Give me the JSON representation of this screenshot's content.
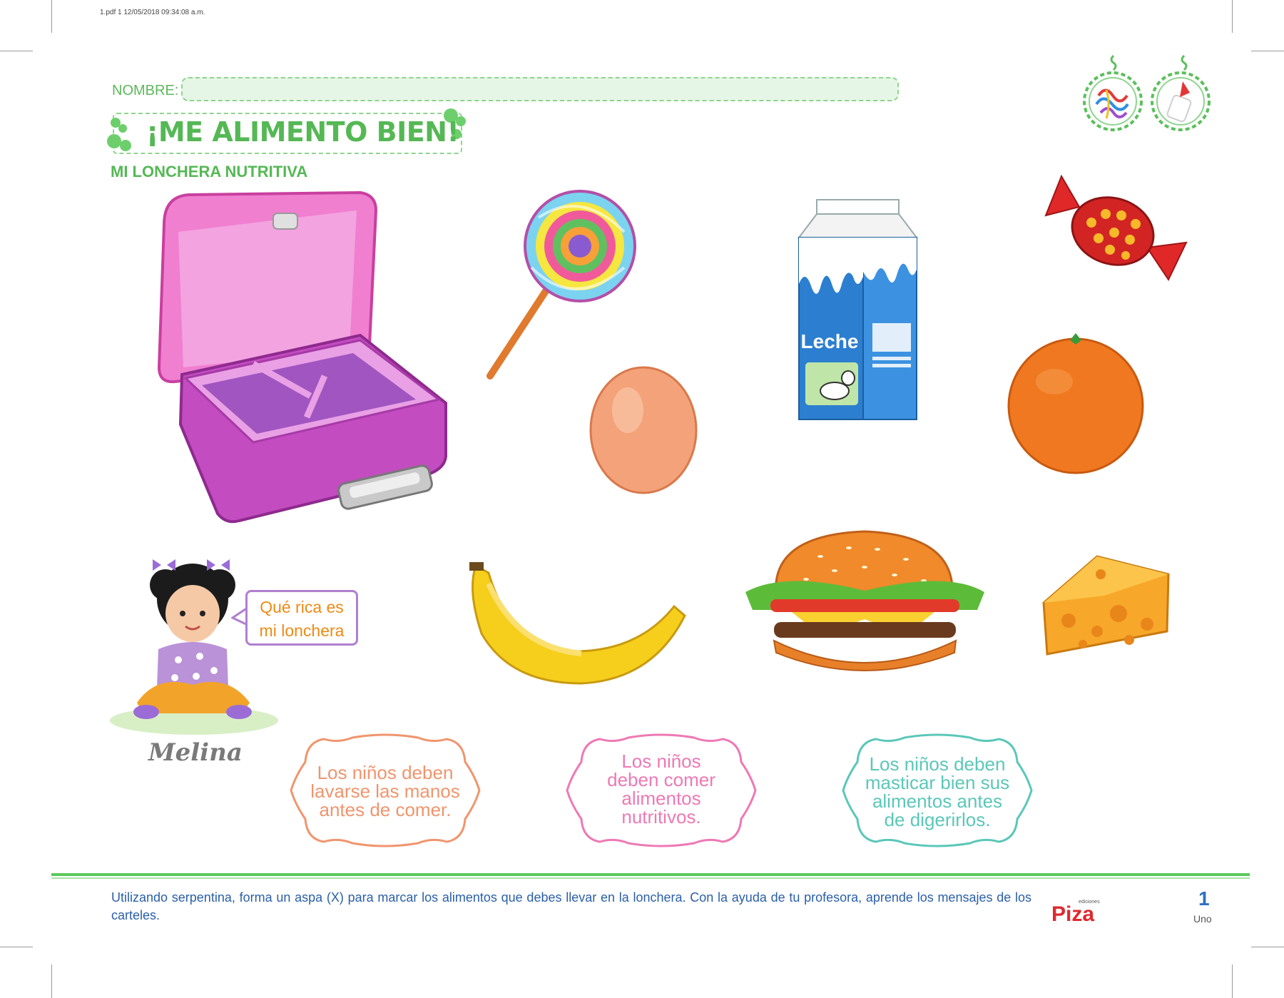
{
  "pdf_header": "1.pdf   1   12/05/2018   09:34:08 a.m.",
  "nombre_label": "NOMBRE:",
  "title": "¡ME ALIMENTO BIEN!",
  "subtitle": "MI LONCHERA NUTRITIVA",
  "speech_bubble": {
    "line1": "Qué rica es",
    "line2": "mi lonchera"
  },
  "character_name": "Melina",
  "milk_label": "Leche",
  "signs": [
    {
      "lines": [
        "Los niños deben",
        "lavarse las manos",
        "antes de comer."
      ],
      "color": "#f0956e"
    },
    {
      "lines": [
        "Los niños",
        "deben comer",
        "alimentos",
        "nutritivos."
      ],
      "color": "#ee79b4"
    },
    {
      "lines": [
        "Los niños deben",
        "masticar bien sus",
        "alimentos antes",
        "de digerirlos."
      ],
      "color": "#5bc7b8"
    }
  ],
  "instruction": "Utilizando serpentina, forma un aspa (X) para marcar los alimentos que debes llevar en la lonchera. Con la ayuda de tu profesora, aprende los mensajes de los carteles.",
  "brand": {
    "small": "ediciones",
    "name": "Piza"
  },
  "page_number": "1",
  "page_word": "Uno",
  "food_items": [
    "lollipop",
    "egg",
    "milk-carton",
    "candy",
    "orange",
    "banana",
    "hamburger",
    "cheese"
  ],
  "colors": {
    "accent_green": "#55b855",
    "instruction_blue": "#2a5fa8",
    "speech_orange": "#ee8a14"
  }
}
